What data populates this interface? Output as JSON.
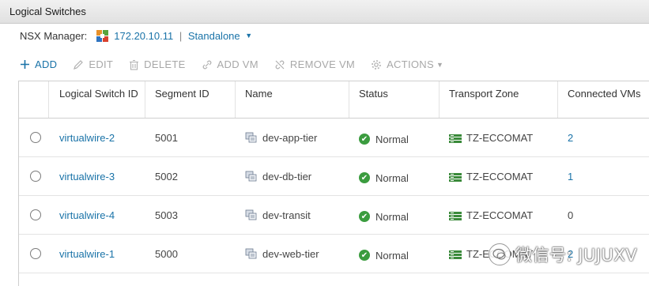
{
  "window": {
    "title": "Logical Switches"
  },
  "manager": {
    "label": "NSX Manager:",
    "ip": "172.20.10.11",
    "separator": "|",
    "mode": "Standalone",
    "icon": "nsx-manager-icon"
  },
  "toolbar": {
    "add": "ADD",
    "edit": "EDIT",
    "delete": "DELETE",
    "add_vm": "ADD VM",
    "remove_vm": "REMOVE VM",
    "actions": "ACTIONS"
  },
  "table": {
    "columns": [
      "Logical Switch ID",
      "Segment ID",
      "Name",
      "Status",
      "Transport Zone",
      "Connected VMs"
    ],
    "rows": [
      {
        "id": "virtualwire-2",
        "segment": "5001",
        "name": "dev-app-tier",
        "status": "Normal",
        "zone": "TZ-ECCOMAT",
        "vms": "2"
      },
      {
        "id": "virtualwire-3",
        "segment": "5002",
        "name": "dev-db-tier",
        "status": "Normal",
        "zone": "TZ-ECCOMAT",
        "vms": "1"
      },
      {
        "id": "virtualwire-4",
        "segment": "5003",
        "name": "dev-transit",
        "status": "Normal",
        "zone": "TZ-ECCOMAT",
        "vms": "0"
      },
      {
        "id": "virtualwire-1",
        "segment": "5000",
        "name": "dev-web-tier",
        "status": "Normal",
        "zone": "TZ-ECCOMAT",
        "vms": "2"
      }
    ]
  },
  "watermark": {
    "text": "微信号: JUJUXV"
  },
  "colors": {
    "link": "#1a73a8",
    "status_ok": "#3b9c3f",
    "header_bg": "#e8e8e8",
    "zone_icon": "#3a8a3a"
  }
}
